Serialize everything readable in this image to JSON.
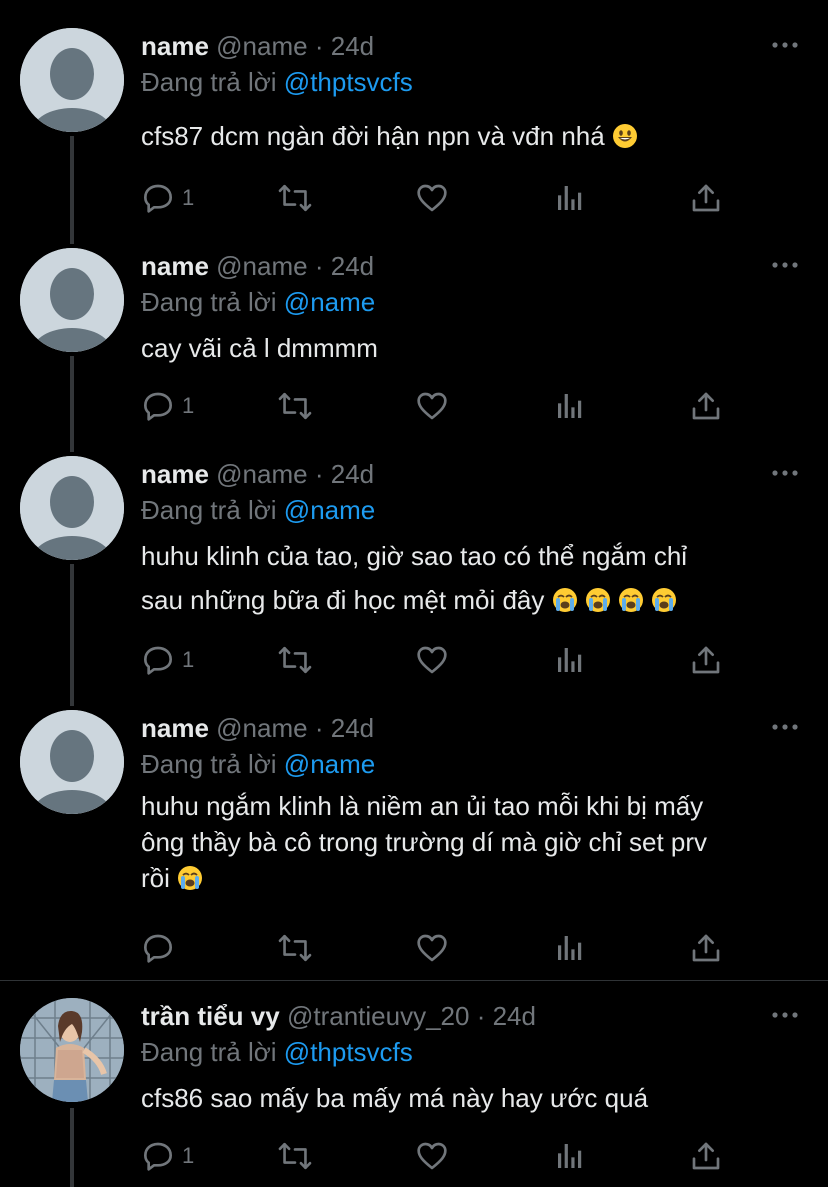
{
  "tweets": [
    {
      "name": "name",
      "handle": "@name",
      "dot": "·",
      "time": "24d",
      "reply_prefix": "Đang trả lời",
      "reply_to": "@thptsvcfs",
      "lines": [
        "cfs87 dcm ngàn đời hận npn và vđn nhá"
      ],
      "reply_count": "1"
    },
    {
      "name": "name",
      "handle": "@name",
      "dot": "·",
      "time": "24d",
      "reply_prefix": "Đang trả lời",
      "reply_to": "@name",
      "lines": [
        "cay vãi cả l dmmmm"
      ],
      "reply_count": "1"
    },
    {
      "name": "name",
      "handle": "@name",
      "dot": "·",
      "time": "24d",
      "reply_prefix": "Đang trả lời",
      "reply_to": "@name",
      "lines": [
        "huhu klinh của tao, giờ sao tao có thể ngắm chỉ",
        "sau những bữa đi học mệt mỏi đây"
      ],
      "reply_count": "1"
    },
    {
      "name": "name",
      "handle": "@name",
      "dot": "·",
      "time": "24d",
      "reply_prefix": "Đang trả lời",
      "reply_to": "@name",
      "lines": [
        "huhu ngắm klinh là niềm an ủi tao mỗi khi bị mấy",
        "ông thầy bà cô trong trường dí mà giờ chỉ set prv",
        "rồi"
      ],
      "reply_count": ""
    },
    {
      "name": "trần tiểu vy",
      "handle": "@trantieuvy_20",
      "dot": "·",
      "time": "24d",
      "reply_prefix": "Đang trả lời",
      "reply_to": "@thptsvcfs",
      "lines": [
        "cfs86 sao mấy ba mấy má này hay ước quá"
      ],
      "reply_count": "1"
    }
  ],
  "icons": {
    "reply": "reply-icon",
    "retweet": "retweet-icon",
    "like": "like-icon",
    "views": "views-icon",
    "share": "share-icon",
    "more": "more-icon",
    "smile_emoji": "grinning-face-emoji",
    "cry_emoji": "loudly-crying-face-emoji"
  },
  "colors": {
    "background": "#000000",
    "text": "#e7e9ea",
    "muted": "#71767b",
    "link": "#1d9bf0",
    "thread_line": "#333639"
  }
}
